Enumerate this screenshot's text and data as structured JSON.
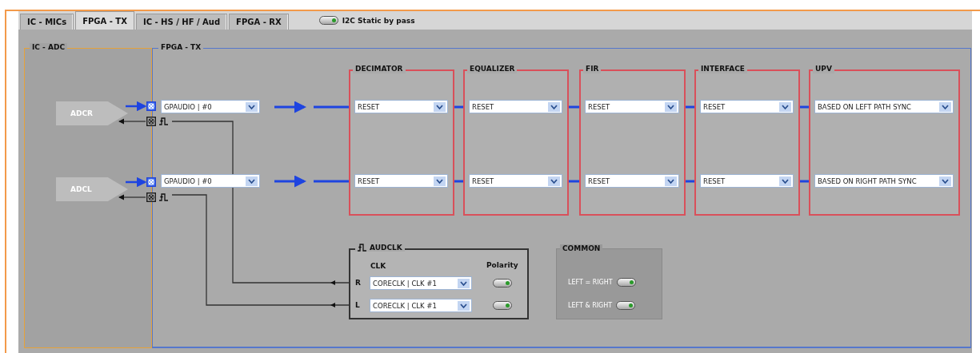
{
  "tabs": [
    {
      "label": "IC - MICs",
      "selected": false
    },
    {
      "label": "FPGA - TX",
      "selected": true
    },
    {
      "label": "IC - HS / HF / Aud",
      "selected": false
    },
    {
      "label": "FPGA - RX",
      "selected": false
    }
  ],
  "bypass_toggle": {
    "label": "I2C Static by pass",
    "on": true
  },
  "ic_adc": {
    "title": "IC - ADC",
    "converters": [
      {
        "label": "ADCR"
      },
      {
        "label": "ADCL"
      }
    ]
  },
  "fpga_tx": {
    "title": "FPGA - TX",
    "inputs": [
      {
        "value": "GPAUDIO | #0"
      },
      {
        "value": "GPAUDIO | #0"
      }
    ],
    "blocks": [
      {
        "title": "DECIMATOR",
        "values": [
          "RESET",
          "RESET"
        ]
      },
      {
        "title": "EQUALIZER",
        "values": [
          "RESET",
          "RESET"
        ]
      },
      {
        "title": "FIR",
        "values": [
          "RESET",
          "RESET"
        ]
      },
      {
        "title": "INTERFACE",
        "values": [
          "RESET",
          "RESET"
        ]
      },
      {
        "title": "UPV",
        "values": [
          "BASED ON LEFT PATH SYNC",
          "BASED ON RIGHT PATH SYNC"
        ]
      }
    ],
    "audclk": {
      "title": "AUDCLK",
      "clk_header": "CLK",
      "polarity_header": "Polarity",
      "rows": [
        {
          "channel": "R",
          "value": "CORECLK | CLK #1",
          "polarity_on": true
        },
        {
          "channel": "L",
          "value": "CORECLK | CLK #1",
          "polarity_on": true
        }
      ]
    },
    "common": {
      "title": "COMMON",
      "toggles": [
        {
          "label": "LEFT = RIGHT",
          "on": true
        },
        {
          "label": "LEFT & RIGHT",
          "on": true
        }
      ]
    }
  }
}
